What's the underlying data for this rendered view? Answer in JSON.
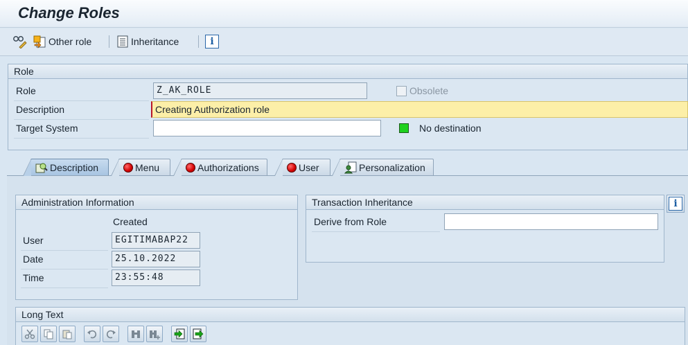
{
  "window": {
    "title": "Change Roles"
  },
  "toolbar": {
    "other_role_label": "Other role",
    "inheritance_label": "Inheritance"
  },
  "role_group": {
    "header": "Role",
    "role_label": "Role",
    "role_value": "Z_AK_ROLE",
    "obsolete_label": "Obsolete",
    "description_label": "Description",
    "description_value": "Creating Authorization role",
    "target_system_label": "Target System",
    "target_system_value": "",
    "destination_status": "No destination"
  },
  "tabs": [
    {
      "label": "Description",
      "icon": "description-icon",
      "active": true
    },
    {
      "label": "Menu",
      "icon": "red-status-icon",
      "active": false
    },
    {
      "label": "Authorizations",
      "icon": "red-status-icon",
      "active": false
    },
    {
      "label": "User",
      "icon": "red-status-icon",
      "active": false
    },
    {
      "label": "Personalization",
      "icon": "personalization-icon",
      "active": false
    }
  ],
  "admin_info": {
    "header": "Administration Information",
    "column_created": "Created",
    "rows": [
      {
        "label": "User",
        "value": "EGITIMABAP22"
      },
      {
        "label": "Date",
        "value": "25.10.2022"
      },
      {
        "label": "Time",
        "value": "23:55:48"
      }
    ]
  },
  "transaction_inheritance": {
    "header": "Transaction Inheritance",
    "derive_label": "Derive from Role",
    "derive_value": ""
  },
  "long_text": {
    "header": "Long Text"
  },
  "colors": {
    "status_green": "#1fd11f",
    "status_red": "#d40000",
    "active_field": "#fcefa8"
  }
}
